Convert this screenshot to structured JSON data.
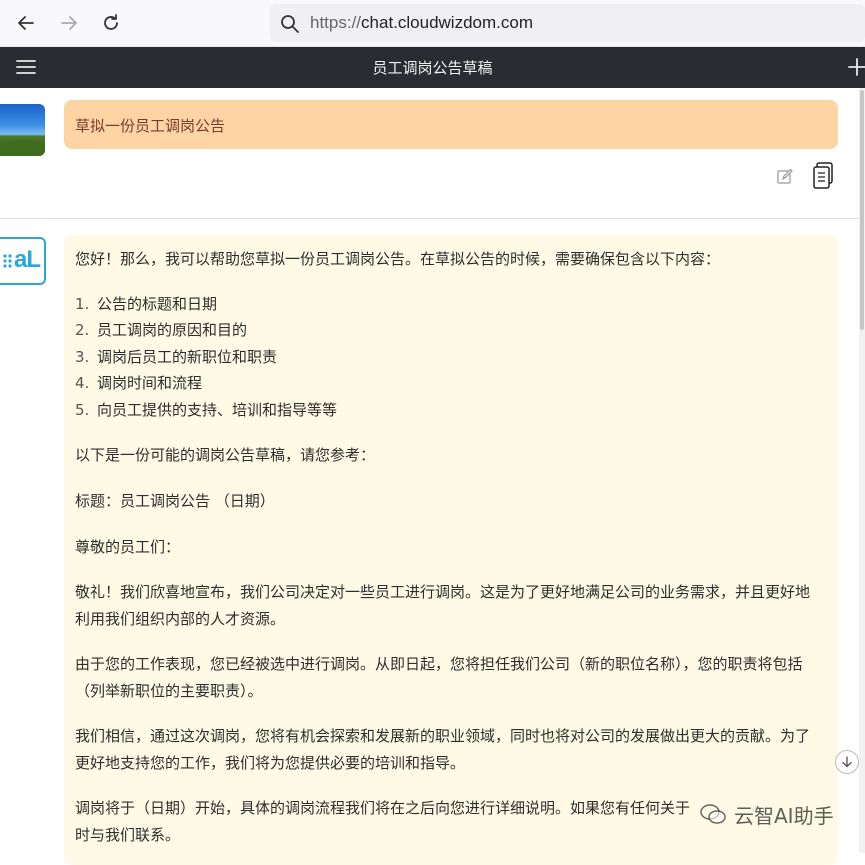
{
  "browser": {
    "url_scheme": "https://",
    "url_host": "chat.cloudwizdom.com"
  },
  "app": {
    "title": "员工调岗公告草稿"
  },
  "user_message": {
    "text": "草拟一份员工调岗公告"
  },
  "ai_message": {
    "intro": "您好！那么，我可以帮助您草拟一份员工调岗公告。在草拟公告的时候，需要确保包含以下内容：",
    "list": [
      {
        "num": "1.",
        "text": "公告的标题和日期"
      },
      {
        "num": "2.",
        "text": "员工调岗的原因和目的"
      },
      {
        "num": "3.",
        "text": "调岗后员工的新职位和职责"
      },
      {
        "num": "4.",
        "text": "调岗时间和流程"
      },
      {
        "num": "5.",
        "text": "向员工提供的支持、培训和指导等等"
      }
    ],
    "lead": "以下是一份可能的调岗公告草稿，请您参考：",
    "heading": "标题：员工调岗公告 （日期）",
    "salutation": "尊敬的员工们：",
    "p1_line1": "敬礼！我们欣喜地宣布，我们公司决定对一些员工进行调岗。这是为了更好地满足公司的业务需求，并且更好地",
    "p1_line2": "利用我们组织内部的人才资源。",
    "p2_line1": "由于您的工作表现，您已经被选中进行调岗。从即日起，您将担任我们公司（新的职位名称），您的职责将包括",
    "p2_line2": "（列举新职位的主要职责）。",
    "p3_line1": "我们相信，通过这次调岗，您将有机会探索和发展新的职业领域，同时也将对公司的发展做出更大的贡献。为了",
    "p3_line2": "更好地支持您的工作，我们将为您提供必要的培训和指导。",
    "p4_line1": "调岗将于（日期）开始，具体的调岗流程我们将在之后向您进行详细说明。如果您有任何关于",
    "p4_line2": "时与我们联系。"
  },
  "watermark": {
    "text": "云智AI助手"
  },
  "colors": {
    "header_bg": "#2b2c33",
    "user_bubble": "#fdd5a4",
    "ai_bubble": "#fffae6",
    "ai_accent": "#2aa7d6"
  }
}
